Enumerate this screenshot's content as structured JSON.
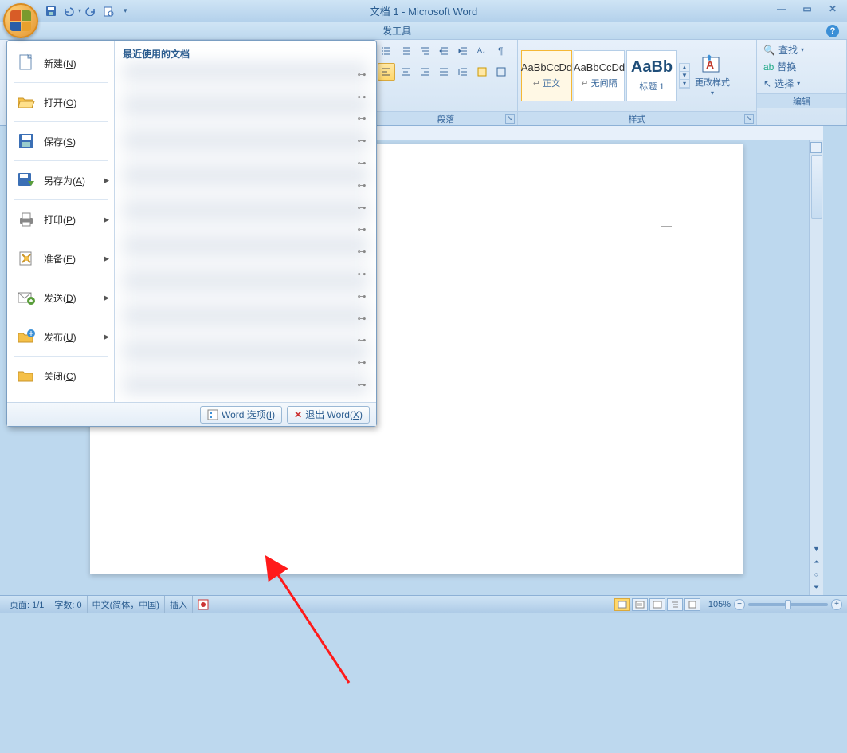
{
  "title": "文档 1 - Microsoft Word",
  "tabs": {
    "developer": "发工具"
  },
  "ribbon": {
    "paragraph_label": "段落",
    "styles_label": "样式",
    "edit_label": "编辑",
    "style1_preview": "AaBbCcDd",
    "style1_name": "正文",
    "style2_preview": "AaBbCcDd",
    "style2_name": "无间隔",
    "style3_preview": "AaBb",
    "style3_name": "标题 1",
    "change_style": "更改样式",
    "find": "查找",
    "replace": "替换",
    "select": "选择"
  },
  "office_menu": {
    "new": "新建(N)",
    "open": "打开(O)",
    "save": "保存(S)",
    "save_as": "另存为(A)",
    "print": "打印(P)",
    "prepare": "准备(E)",
    "send": "发送(D)",
    "publish": "发布(U)",
    "close": "关闭(C)",
    "recent_title": "最近使用的文档",
    "word_options": "Word 选项(I)",
    "exit_word": "退出 Word(X)"
  },
  "status": {
    "page": "页面: 1/1",
    "words": "字数: 0",
    "lang": "中文(简体，中国)",
    "mode": "插入",
    "zoom": "105%"
  }
}
